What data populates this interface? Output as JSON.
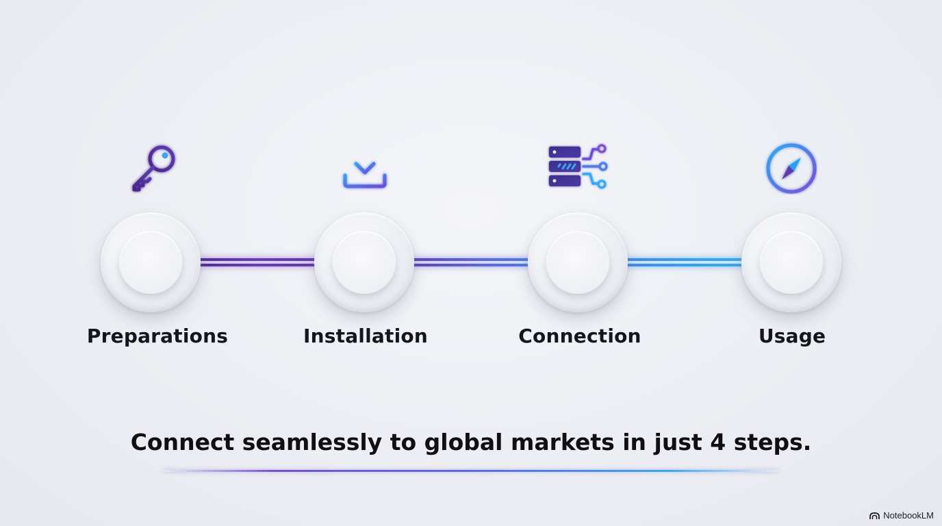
{
  "steps": [
    {
      "label": "Preparations",
      "icon": "key-icon"
    },
    {
      "label": "Installation",
      "icon": "download-icon"
    },
    {
      "label": "Connection",
      "icon": "server-network-icon"
    },
    {
      "label": "Usage",
      "icon": "compass-icon"
    }
  ],
  "tagline": "Connect seamlessly to global markets in just 4 steps.",
  "brand": {
    "name": "NotebookLM",
    "icon": "notebooklm-logo-icon"
  },
  "colors": {
    "purple": "#5a2fa0",
    "indigo": "#5d66d8",
    "blue": "#3aa6f0",
    "text": "#15151c"
  }
}
